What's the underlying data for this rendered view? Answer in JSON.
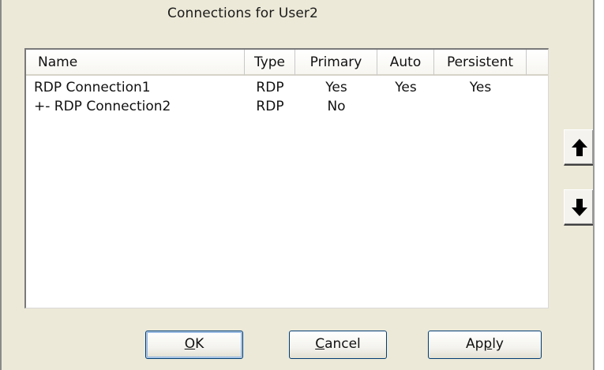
{
  "dialog": {
    "title": "Connections for User2"
  },
  "list": {
    "columns": {
      "name": "Name",
      "type": "Type",
      "primary": "Primary",
      "auto": "Auto",
      "persistent": "Persistent"
    },
    "rows": [
      {
        "name": "RDP Connection1",
        "type": "RDP",
        "primary": "Yes",
        "auto": "Yes",
        "persistent": "Yes"
      },
      {
        "name": "+- RDP Connection2",
        "type": "RDP",
        "primary": "No",
        "auto": "",
        "persistent": ""
      }
    ]
  },
  "side_buttons": {
    "move_up_icon": "arrow-up-icon",
    "move_down_icon": "arrow-down-icon"
  },
  "buttons": {
    "ok": {
      "accel": "O",
      "rest": "K"
    },
    "cancel": {
      "accel": "C",
      "rest": "ancel"
    },
    "apply": {
      "pre": "Ap",
      "accel": "p",
      "rest": "ly"
    }
  },
  "colors": {
    "dialog_bg": "#ece9d8",
    "button_border": "#003c74"
  }
}
